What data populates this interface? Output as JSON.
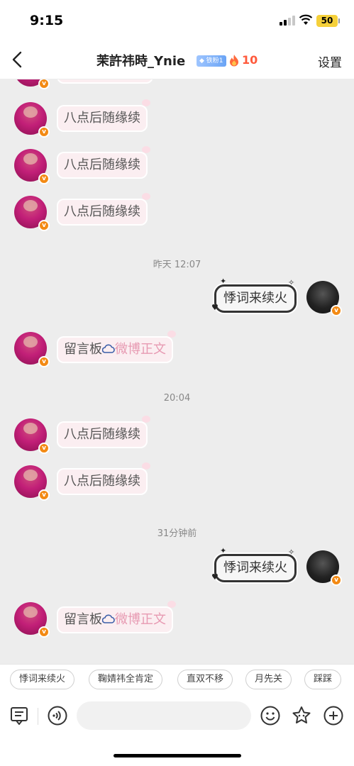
{
  "status_bar": {
    "time": "9:15",
    "battery": "50"
  },
  "header": {
    "title": "茉許祎時_Ynie",
    "fan_badge": "铁粉1",
    "fire_count": "10",
    "settings_label": "设置"
  },
  "messages": {
    "eight_point": "八点后随缘续",
    "reply_right": "悸词来续火",
    "board": "留言板",
    "weibo": "微博正文",
    "time_1": "昨天 12:07",
    "time_2": "20:04",
    "time_3": "31分钟前"
  },
  "quick_replies": [
    "悸词来续火",
    "鞠婧祎全肯定",
    "直双不移",
    "月先关",
    "踩踩"
  ],
  "input": {
    "placeholder": ""
  },
  "icons": {
    "badge_letter": "v",
    "back": "chevron-left-icon",
    "fire": "fire-icon",
    "menu": "note-list-icon",
    "voice": "voice-icon",
    "emoji": "smile-icon",
    "sticker": "star-face-icon",
    "add": "plus-icon"
  },
  "colors": {
    "chat_bg": "#ededed",
    "bubble_left": "#fbeef1",
    "weibo_pink": "#e79ab2",
    "fire_red": "#ff5a3c",
    "verified_orange": "#f38a14"
  }
}
